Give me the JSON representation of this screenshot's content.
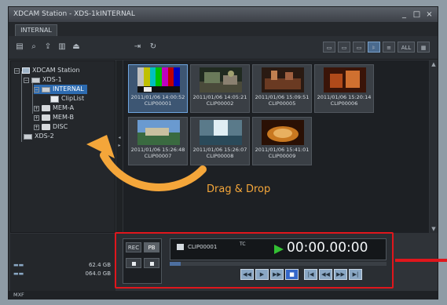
{
  "window": {
    "title": "XDCAM Station - XDS-1kINTERNAL",
    "min": "_",
    "max": "□",
    "close": "×"
  },
  "tabs": [
    {
      "label": "INTERNAL"
    }
  ],
  "toolbar": {
    "all_label": "ALL"
  },
  "tree": {
    "items": [
      {
        "label": "XDCAM Station"
      },
      {
        "label": "XDS-1"
      },
      {
        "label": "INTERNAL"
      },
      {
        "label": "ClipList"
      },
      {
        "label": "MEM-A"
      },
      {
        "label": "MEM-B"
      },
      {
        "label": "DISC"
      },
      {
        "label": "XDS-2"
      }
    ]
  },
  "clips": [
    {
      "date": "2011/01/06 14:00:52",
      "name": "CLIP00001"
    },
    {
      "date": "2011/01/06 14:05:21",
      "name": "CLIP00002"
    },
    {
      "date": "2011/01/06 15:09:51",
      "name": "CLIP00005"
    },
    {
      "date": "2011/01/06 15:20:14",
      "name": "CLIP00006"
    },
    {
      "date": "2011/01/06 15:26:48",
      "name": "CLIP00007"
    },
    {
      "date": "2011/01/06 15:26:07",
      "name": "CLIP00008"
    },
    {
      "date": "2011/01/06 15:41:01",
      "name": "CLIP00009"
    }
  ],
  "info": {
    "value1": "62.4 GB",
    "value2": "064.0 GB"
  },
  "annotation": {
    "drag_label": "Drag & Drop"
  },
  "player": {
    "rec_label": "REC",
    "pb_label": "PB",
    "clip_name": "CLIP00001",
    "tc_label": "TC",
    "timecode": "00:00.00:00",
    "progress": 0.05
  },
  "status": {
    "text": "MXF"
  },
  "colors": {
    "accent_red": "#e0161c",
    "drag_orange": "#f4a63a",
    "play_green": "#33c033",
    "selection_blue": "#2d6bb0"
  }
}
